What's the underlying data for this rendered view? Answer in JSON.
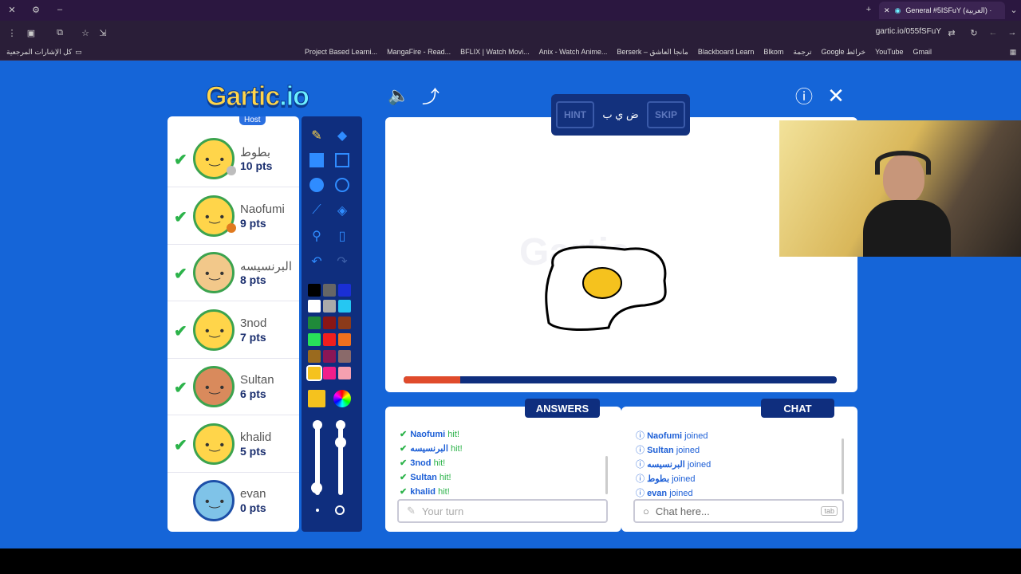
{
  "browser": {
    "tab_title": "General #5ISFuY (العربية) ·",
    "url": "gartic.io/055fSFuY",
    "bookmarks": [
      "Project Based Learni...",
      "MangaFire - Read...",
      "BFLIX | Watch Movi...",
      "Anix - Watch Anime...",
      "Berserk – مانجا العاشق",
      "Blackboard Learn",
      "Blkom",
      "ترجمة",
      "Google خرائط",
      "YouTube",
      "Gmail"
    ],
    "all_bookmarks": "كل الإشارات المرجعية"
  },
  "game": {
    "logo_main": "Gartic",
    "logo_suffix": "io",
    "host_label": "Host",
    "players": [
      {
        "name": "بطوط",
        "pts": "10 pts",
        "dot": "#bdbdbd"
      },
      {
        "name": "Naofumi",
        "pts": "9 pts",
        "dot": "#e07a1f"
      },
      {
        "name": "البرنسيسه",
        "pts": "8 pts"
      },
      {
        "name": "3nod",
        "pts": "7 pts"
      },
      {
        "name": "Sultan",
        "pts": "6 pts"
      },
      {
        "name": "khalid",
        "pts": "5 pts"
      },
      {
        "name": "evan",
        "pts": "0 pts"
      }
    ],
    "hint_label": "HINT",
    "skip_label": "SKIP",
    "word_hint": "ض ي ب",
    "progress_fraction": 0.13,
    "answers_title": "ANSWERS",
    "chat_title": "CHAT",
    "answers": [
      {
        "name": "Naofumi",
        "text": "hit!"
      },
      {
        "name": "البرنسيسه",
        "text": "hit!"
      },
      {
        "name": "3nod",
        "text": "hit!"
      },
      {
        "name": "Sultan",
        "text": "hit!"
      },
      {
        "name": "khalid",
        "text": "hit!"
      }
    ],
    "chat": [
      {
        "name": "Naofumi",
        "text": "joined"
      },
      {
        "name": "Sultan",
        "text": "joined"
      },
      {
        "name": "البرنسيسه",
        "text": "joined"
      },
      {
        "name": "بطوط",
        "text": "joined"
      },
      {
        "name": "evan",
        "text": "joined"
      }
    ],
    "answer_placeholder": "Your turn",
    "chat_placeholder": "Chat here...",
    "tab_hint": "tab",
    "colors": {
      "background": "#1565d8",
      "panel_dark": "#0f2e7e",
      "hit_green": "#2cb34a",
      "progress": "#e04b2b"
    }
  }
}
